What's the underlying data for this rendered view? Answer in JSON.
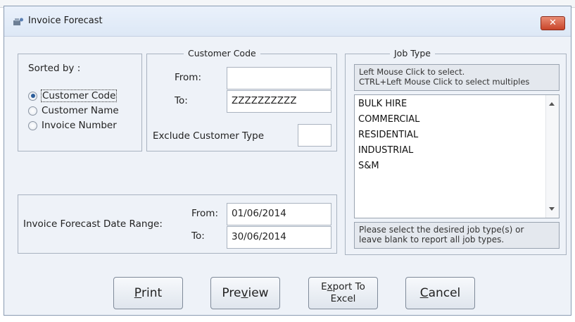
{
  "window": {
    "title": "Invoice Forecast",
    "close_label": "✕"
  },
  "sorted_by": {
    "heading": "Sorted by :",
    "options": [
      {
        "label": "Customer Code",
        "checked": true
      },
      {
        "label": "Customer Name",
        "checked": false
      },
      {
        "label": "Invoice Number",
        "checked": false
      }
    ]
  },
  "customer_code": {
    "legend": "Customer Code",
    "from_label": "From:",
    "from_value": "",
    "to_label": "To:",
    "to_value": "ZZZZZZZZZZ",
    "exclude_label": "Exclude Customer Type",
    "exclude_value": ""
  },
  "date_range": {
    "label": "Invoice Forecast Date Range:",
    "from_label": "From:",
    "from_value": "01/06/2014",
    "to_label": "To:",
    "to_value": "30/06/2014"
  },
  "job_type": {
    "legend": "Job Type",
    "hint_line1": "Left Mouse Click to select.",
    "hint_line2": "CTRL+Left Mouse Click to select multiples",
    "items": [
      "BULK HIRE",
      "COMMERCIAL",
      "RESIDENTIAL",
      "INDUSTRIAL",
      "S&M"
    ],
    "footer_line1": "Please select the desired job type(s) or",
    "footer_line2": "leave blank to report all job types."
  },
  "buttons": {
    "print": {
      "accel": "P",
      "rest": "rint"
    },
    "preview": {
      "pre": "Pre",
      "accel": "v",
      "post": "iew"
    },
    "export": {
      "pre": "E",
      "accel": "x",
      "post": "port To",
      "line2": "Excel"
    },
    "cancel": {
      "accel": "C",
      "rest": "ancel"
    }
  }
}
